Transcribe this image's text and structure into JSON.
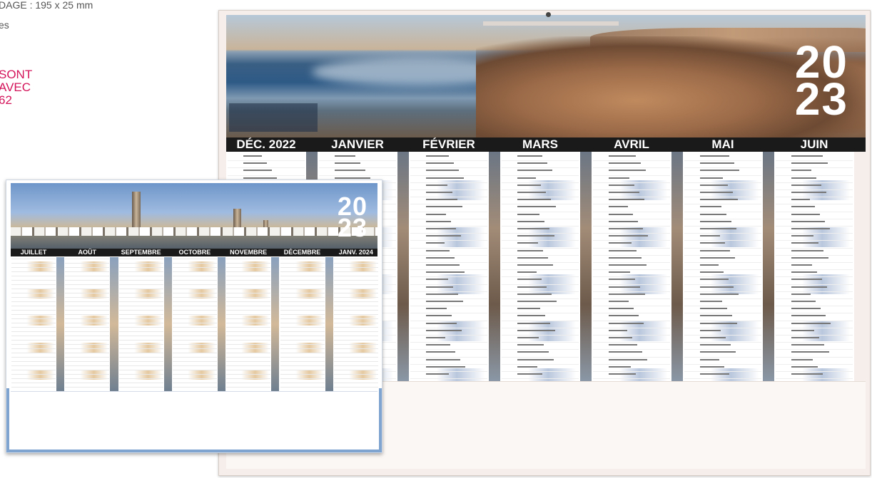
{
  "caption": {
    "line1": "DAGE : 195 x 25 mm",
    "line2": "es",
    "red_lines": [
      "SONT",
      "AVEC",
      "62"
    ]
  },
  "big_calendar": {
    "year_top": "20",
    "year_bottom": "23",
    "months": [
      "DÉC. 2022",
      "JANVIER",
      "FÉVRIER",
      "MARS",
      "AVRIL",
      "MAI",
      "JUIN"
    ]
  },
  "small_calendar": {
    "year_top": "20",
    "year_bottom": "23",
    "months": [
      "JUILLET",
      "AOÛT",
      "SEPTEMBRE",
      "OCTOBRE",
      "NOVEMBRE",
      "DÉCEMBRE",
      "JANV. 2024"
    ]
  },
  "colors": {
    "accent_red": "#d4145a",
    "header_black": "#1a1a1a",
    "weekend_red": "#e0202a",
    "frame_blue": "#7fa4cf"
  }
}
